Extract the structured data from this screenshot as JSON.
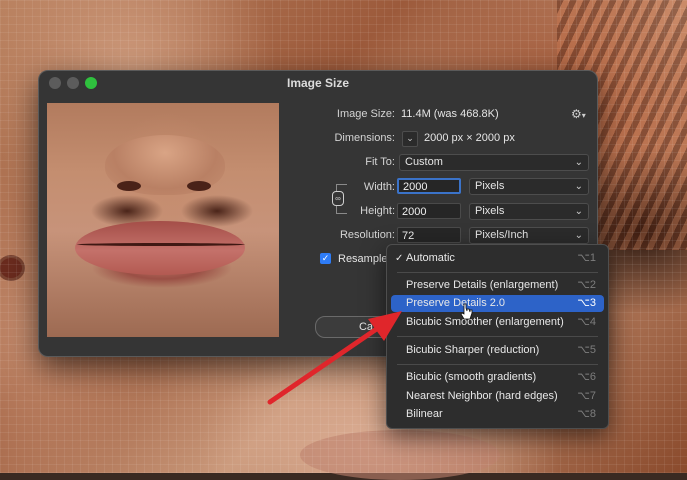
{
  "dialog": {
    "title": "Image Size",
    "image_size_label": "Image Size:",
    "image_size_value": "11.4M (was 468.8K)",
    "dimensions_label": "Dimensions:",
    "dimensions_value": "2000 px  ×  2000 px",
    "fit_to_label": "Fit To:",
    "fit_to_value": "Custom",
    "width_label": "Width:",
    "width_value": "2000",
    "width_unit": "Pixels",
    "height_label": "Height:",
    "height_value": "2000",
    "height_unit": "Pixels",
    "resolution_label": "Resolution:",
    "resolution_value": "72",
    "resolution_unit": "Pixels/Inch",
    "resample_label": "Resample",
    "resample_checked": true,
    "cancel_label": "Ca"
  },
  "resample_menu": {
    "items": [
      {
        "label": "Automatic",
        "shortcut": "⌥1",
        "checked": true,
        "highlighted": false
      },
      {
        "label": "Preserve Details (enlargement)",
        "shortcut": "⌥2",
        "highlighted": false
      },
      {
        "label": "Preserve Details 2.0",
        "shortcut": "⌥3",
        "highlighted": true
      },
      {
        "label": "Bicubic Smoother (enlargement)",
        "shortcut": "⌥4",
        "highlighted": false
      },
      {
        "label": "Bicubic Sharper (reduction)",
        "shortcut": "⌥5",
        "highlighted": false
      },
      {
        "label": "Bicubic (smooth gradients)",
        "shortcut": "⌥6",
        "highlighted": false
      },
      {
        "label": "Nearest Neighbor (hard edges)",
        "shortcut": "⌥7",
        "highlighted": false
      },
      {
        "label": "Bilinear",
        "shortcut": "⌥8",
        "highlighted": false
      }
    ]
  },
  "colors": {
    "highlight": "#2d63c8",
    "annotation_arrow": "#e0262b",
    "zoom_button": "#2fc13e"
  },
  "icons": {
    "gear": "gear-icon",
    "link": "link-icon",
    "checkmark": "checkmark-icon",
    "chevron": "chevron-down-icon",
    "cursor": "pointer-cursor-icon"
  }
}
